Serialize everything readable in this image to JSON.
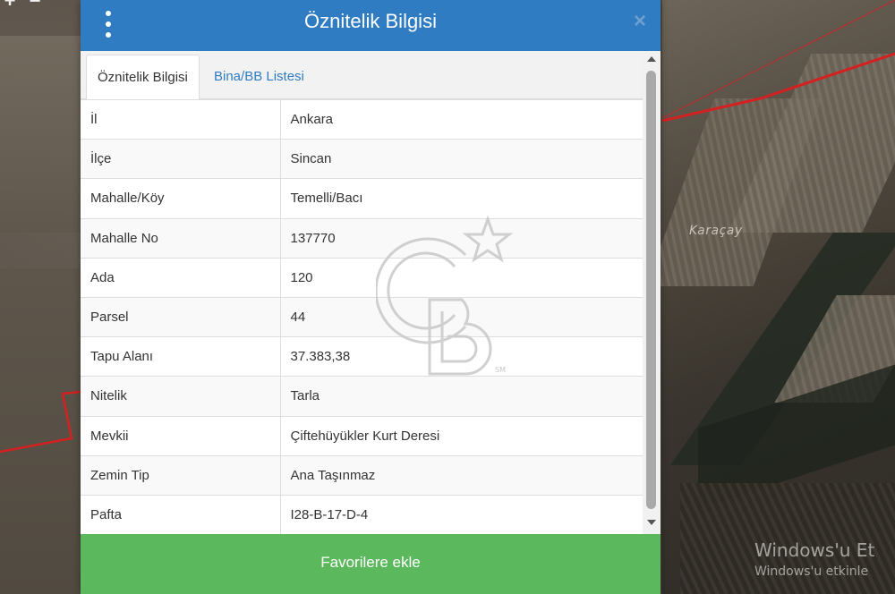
{
  "map": {
    "place_label": "Karaçay",
    "zoom_in_label": "+",
    "zoom_out_label": "−",
    "os_watermark": {
      "line1": "Windows'u Et",
      "line2": "Windows'u etkinle"
    }
  },
  "modal": {
    "title": "Öznitelik Bilgisi",
    "close_label": "×",
    "tabs": [
      {
        "label": "Öznitelik Bilgisi",
        "active": true
      },
      {
        "label": "Bina/BB Listesi",
        "active": false
      }
    ],
    "rows": [
      {
        "key": "İl",
        "value": "Ankara"
      },
      {
        "key": "İlçe",
        "value": "Sincan"
      },
      {
        "key": "Mahalle/Köy",
        "value": "Temelli/Bacı"
      },
      {
        "key": "Mahalle No",
        "value": "137770"
      },
      {
        "key": "Ada",
        "value": "120"
      },
      {
        "key": "Parsel",
        "value": "44"
      },
      {
        "key": "Tapu Alanı",
        "value": "37.383,38"
      },
      {
        "key": "Nitelik",
        "value": "Tarla"
      },
      {
        "key": "Mevkii",
        "value": "Çiftehüyükler Kurt Deresi"
      },
      {
        "key": "Zemin Tip",
        "value": "Ana Taşınmaz"
      },
      {
        "key": "Pafta",
        "value": "I28-B-17-D-4"
      }
    ],
    "favorite_button_label": "Favorilere ekle"
  },
  "colors": {
    "header": "#2f7cc2",
    "favorite_button": "#5cb85c",
    "tab_link": "#2f7cc2",
    "parcel_border": "#d42020"
  },
  "icons": {
    "menu": "kebab-menu-icon",
    "close": "close-icon",
    "logo": "coldwell-banker-watermark-logo"
  }
}
